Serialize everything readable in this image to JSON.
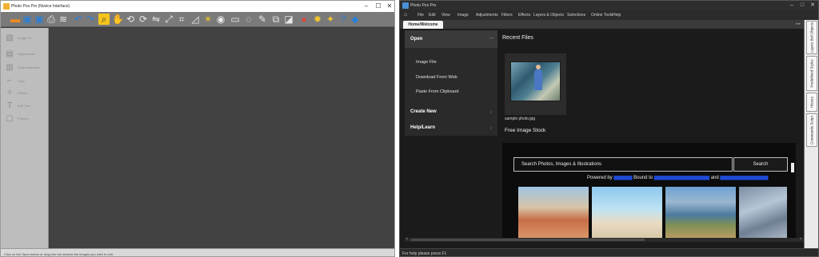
{
  "left_window": {
    "title": "Photo Pos Pro (Novice Interface)",
    "controls": {
      "minimize": "–",
      "maximize": "☐",
      "close": "✕"
    },
    "toolbar": [
      {
        "name": "open-icon",
        "glyph": "▬",
        "style": "orange"
      },
      {
        "name": "save-icon",
        "glyph": "▣",
        "style": "blue"
      },
      {
        "name": "save-as-icon",
        "glyph": "▣",
        "style": "blue"
      },
      {
        "name": "print-icon",
        "glyph": "⎙",
        "style": ""
      },
      {
        "name": "scanner-icon",
        "glyph": "≋",
        "style": ""
      },
      {
        "name": "undo-icon",
        "glyph": "↶",
        "style": "blue"
      },
      {
        "name": "redo-icon",
        "glyph": "↷",
        "style": "blue"
      },
      {
        "name": "zoom-icon",
        "glyph": "⌕",
        "style": "hl"
      },
      {
        "name": "hand-icon",
        "glyph": "✋",
        "style": ""
      },
      {
        "name": "rotate-left-icon",
        "glyph": "⟲",
        "style": ""
      },
      {
        "name": "rotate-right-icon",
        "glyph": "⟳",
        "style": ""
      },
      {
        "name": "flip-icon",
        "glyph": "⇋",
        "style": ""
      },
      {
        "name": "resize-icon",
        "glyph": "⤢",
        "style": ""
      },
      {
        "name": "crop-icon",
        "glyph": "⌗",
        "style": ""
      },
      {
        "name": "straighten-icon",
        "glyph": "◿",
        "style": ""
      },
      {
        "name": "exposure-icon",
        "glyph": "☀",
        "style": "yel"
      },
      {
        "name": "redeye-icon",
        "glyph": "◉",
        "style": ""
      },
      {
        "name": "frame-icon",
        "glyph": "▭",
        "style": ""
      },
      {
        "name": "lasso-icon",
        "glyph": "◌",
        "style": ""
      },
      {
        "name": "brush-icon",
        "glyph": "✎",
        "style": ""
      },
      {
        "name": "clone-icon",
        "glyph": "⧉",
        "style": ""
      },
      {
        "name": "text-icon",
        "glyph": "◪",
        "style": ""
      },
      {
        "name": "pin-icon",
        "glyph": "●",
        "style": "red"
      },
      {
        "name": "sun-icon",
        "glyph": "✹",
        "style": "yel"
      },
      {
        "name": "star-icon",
        "glyph": "✦",
        "style": "yel"
      },
      {
        "name": "help-icon",
        "glyph": "?",
        "style": "blue"
      },
      {
        "name": "info-icon",
        "glyph": "◆",
        "style": "blue"
      }
    ],
    "sidebar": [
      {
        "label": "Image Fix",
        "glyph": "▧"
      },
      {
        "label": "Adjustments",
        "glyph": "▤"
      },
      {
        "label": "Softproofination",
        "glyph": "▥"
      },
      {
        "label": "Crop",
        "glyph": "⌐"
      },
      {
        "label": "Effects",
        "glyph": "✧"
      },
      {
        "label": "Add Text",
        "glyph": "T"
      },
      {
        "label": "Frames",
        "glyph": "▢"
      }
    ],
    "status": "Click on the Open button or drag into the window the images you wish to edit"
  },
  "right_window": {
    "title": "Photo Pos Pro",
    "controls": {
      "minimize": "–",
      "maximize": "□",
      "close": "✕"
    },
    "menu": [
      "File",
      "Edit",
      "View",
      "Image",
      "Adjustments",
      "Filters",
      "Effects",
      "Layers & Objects",
      "Selections",
      "Online Tools",
      "Help"
    ],
    "tab": "Home/Welcome",
    "tab_dots": "◂ ▸",
    "docks": [
      "Layers Brd Objects",
      "Predefined Styles",
      "History",
      "Commands Script"
    ],
    "open_panel": {
      "title": "Open",
      "collapse": "—",
      "items": [
        "Image File",
        "Download From Web",
        "Paste From Clipboard"
      ],
      "sections": [
        "Create New",
        "Help/Learn"
      ],
      "arrow": "›"
    },
    "recent": {
      "title": "Recent Files",
      "file_caption": "sample photo.jpg"
    },
    "stock": {
      "title": "Free Image Stock",
      "search_placeholder": "Search Photos, Images & Illustrations",
      "search_button": "Search",
      "powered_by": "Powered by",
      "bound_to": "Bound to",
      "and": "and"
    },
    "status": "For help please press F1"
  }
}
